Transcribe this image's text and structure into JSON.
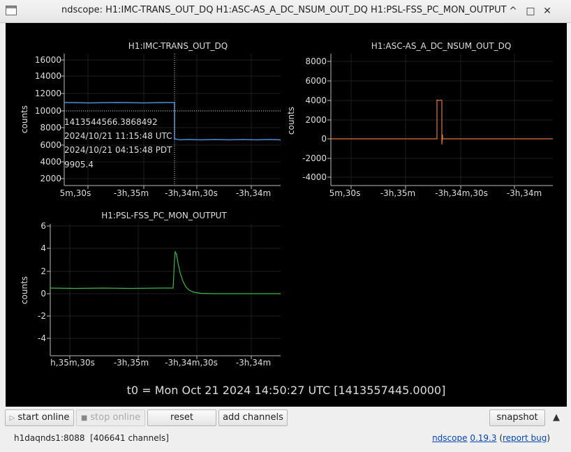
{
  "window": {
    "title": "ndscope: H1:IMC-TRANS_OUT_DQ H1:ASC-AS_A_DC_NSUM_OUT_DQ H1:PSL-FSS_PC_MON_OUTPUT",
    "minimize": "^",
    "maximize": "□",
    "close": "✕"
  },
  "colors": {
    "background": "#000000",
    "axis": "#bbbbbb",
    "grid": "#1e1e1e",
    "imc_trace": "#4a8fd4",
    "asc_trace": "#e07838",
    "psl_trace": "#3cb84a",
    "cursor": "#cccccc"
  },
  "plots": [
    {
      "title": "H1:IMC-TRANS_OUT_DQ",
      "ylabel": "counts",
      "yticks": [
        "16000",
        "14000",
        "12000",
        "10000",
        "8000",
        "6000",
        "4000",
        "2000"
      ],
      "xticks": [
        "5m,30s",
        "-3h,35m",
        "-3h,34m,30s",
        "-3h,34m"
      ],
      "cursor_readout": [
        "1413544566.3868492",
        "2024/10/21 11:15:48 UTC",
        "2024/10/21 04:15:48 PDT",
        "9905.4"
      ]
    },
    {
      "title": "H1:ASC-AS_A_DC_NSUM_OUT_DQ",
      "ylabel": "counts",
      "yticks": [
        "8000",
        "6000",
        "4000",
        "2000",
        "0",
        "-2000",
        "-4000"
      ],
      "xticks": [
        "5m,30s",
        "-3h,35m",
        "-3h,34m,30s",
        "-3h,34m"
      ]
    },
    {
      "title": "H1:PSL-FSS_PC_MON_OUTPUT",
      "ylabel": "counts",
      "yticks": [
        "6",
        "4",
        "2",
        "0",
        "-2",
        "-4"
      ],
      "xticks": [
        "h,35m,30s",
        "-3h,35m",
        "-3h,34m,30s",
        "-3h,34m"
      ]
    }
  ],
  "t0_label": "t0 = Mon Oct 21 2024 14:50:27 UTC [1413557445.0000]",
  "buttons": {
    "start_online": "start online",
    "stop_online": "stop online",
    "reset": "reset",
    "add_channels": "add channels",
    "snapshot": "snapshot",
    "collapse": "▲"
  },
  "status": {
    "server": "h1daqnds1:8088  [406641 channels]",
    "app_link": "ndscope",
    "version": "0.19.3",
    "report_prefix": "(",
    "report_link": "report bug",
    "report_suffix": ")"
  }
}
